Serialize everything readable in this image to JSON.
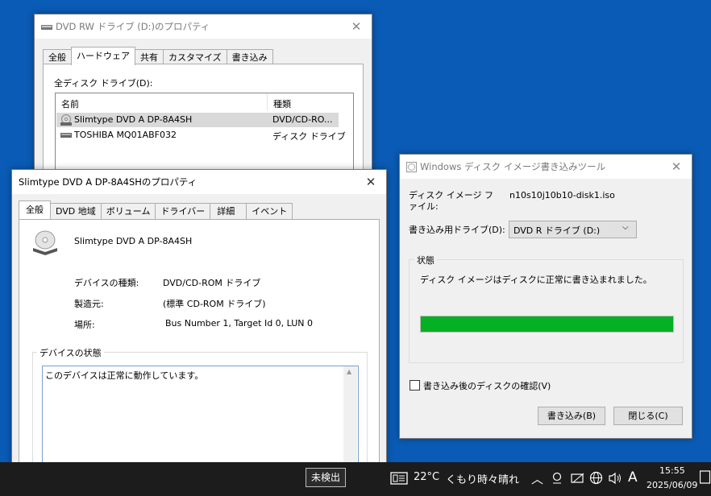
{
  "dvd_props": {
    "title": "DVD RW ドライブ (D:)のプロパティ",
    "tabs": [
      "全般",
      "ハードウェア",
      "共有",
      "カスタマイズ",
      "書き込み"
    ],
    "list_label": "全ディスク ドライブ(D):",
    "columns": [
      "名前",
      "種類"
    ],
    "rows": [
      {
        "name": "Slimtype DVD A  DP-8A4SH",
        "type": "DVD/CD-RO..."
      },
      {
        "name": "TOSHIBA MQ01ABF032",
        "type": "ディスク ドライブ"
      }
    ]
  },
  "device_props": {
    "title": "Slimtype DVD A  DP-8A4SHのプロパティ",
    "tabs": [
      "全般",
      "DVD 地域",
      "ボリューム",
      "ドライバー",
      "詳細",
      "イベント"
    ],
    "device_name": "Slimtype DVD A  DP-8A4SH",
    "fields": [
      {
        "label": "デバイスの種類:",
        "value": "DVD/CD-ROM ドライブ"
      },
      {
        "label": "製造元:",
        "value": "(標準 CD-ROM ドライブ)"
      },
      {
        "label": "場所:",
        "value": "Bus Number 1, Target Id 0, LUN 0"
      }
    ],
    "status_group": "デバイスの状態",
    "status_text": "このデバイスは正常に動作しています。"
  },
  "burner": {
    "title": "Windows ディスク イメージ書き込みツール",
    "image_label": "ディスク イメージ ファイル:",
    "image_value": "n10s10j10b10-disk1.iso",
    "drive_label": "書き込み用ドライブ(D):",
    "drive_value": "DVD R ドライブ (D:)",
    "status_group": "状態",
    "status_text": "ディスク イメージはディスクに正常に書き込まれました。",
    "progress": 1.0,
    "verify_label": "書き込み後のディスクの確認(V)",
    "verify_checked": false,
    "burn_button": "書き込み(B)",
    "close_button": "閉じる(C)",
    "progress_color": "#06b025"
  },
  "taskbar": {
    "tooltip": "未検出",
    "temperature": "22°C",
    "weather": "くもり時々晴れ",
    "ime": "A",
    "time": "15:55",
    "date": "2025/06/09"
  },
  "colors": {
    "desktop": "#0a5bb5",
    "taskbar": "#1c1c1c",
    "selection": "#cce8ff"
  }
}
